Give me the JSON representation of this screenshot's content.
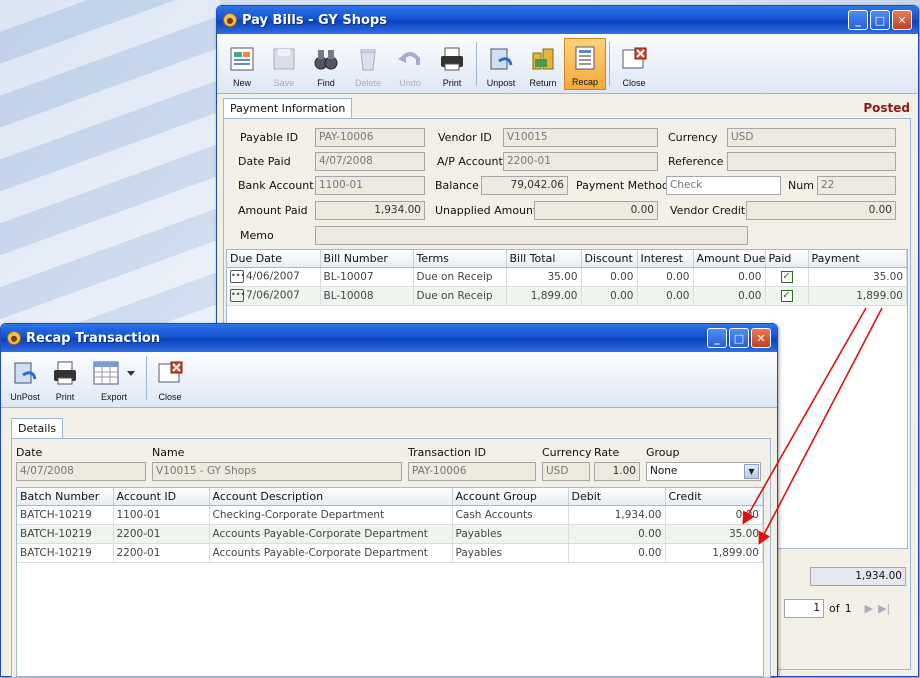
{
  "paybills": {
    "title": "Pay Bills - GY Shops",
    "toolbar": [
      "New",
      "Save",
      "Find",
      "Delete",
      "Undo",
      "Print",
      "Unpost",
      "Return",
      "Recap",
      "Close"
    ],
    "tab": "Payment Information",
    "status": "Posted",
    "fields": {
      "payable_id_label": "Payable ID",
      "payable_id": "PAY-10006",
      "vendor_id_label": "Vendor ID",
      "vendor_id": "V10015",
      "currency_label": "Currency",
      "currency": "USD",
      "date_paid_label": "Date Paid",
      "date_paid": "4/07/2008",
      "ap_account_label": "A/P Account",
      "ap_account": "2200-01",
      "reference_label": "Reference",
      "reference": "",
      "bank_account_label": "Bank Account",
      "bank_account": "1100-01",
      "balance_label": "Balance",
      "balance": "79,042.06",
      "payment_method_label": "Payment Method",
      "payment_method": "Check",
      "num_label": "Num",
      "num": "22",
      "amount_paid_label": "Amount Paid",
      "amount_paid": "1,934.00",
      "unapplied_label": "Unapplied Amount",
      "unapplied": "0.00",
      "vendor_credit_label": "Vendor Credit",
      "vendor_credit": "0.00",
      "memo_label": "Memo",
      "memo": ""
    },
    "grid": {
      "columns": [
        "Due Date",
        "Bill Number",
        "Terms",
        "Bill Total",
        "Discount",
        "Interest",
        "Amount Due",
        "Paid",
        "Payment"
      ],
      "rows": [
        {
          "due_date": "4/06/2007",
          "bill": "BL-10007",
          "terms": "Due on Receip",
          "total": "35.00",
          "discount": "0.00",
          "interest": "0.00",
          "amount_due": "0.00",
          "payment": "35.00"
        },
        {
          "due_date": "7/06/2007",
          "bill": "BL-10008",
          "terms": "Due on Receip",
          "total": "1,899.00",
          "discount": "0.00",
          "interest": "0.00",
          "amount_due": "0.00",
          "payment": "1,899.00"
        }
      ]
    },
    "footer_total": "1,934.00",
    "pager": {
      "page": "1",
      "of": "of",
      "total": "1"
    }
  },
  "recap": {
    "title": "Recap Transaction",
    "toolbar": [
      "UnPost",
      "Print",
      "Export",
      "Close"
    ],
    "tab": "Details",
    "labels": {
      "date": "Date",
      "name": "Name",
      "transaction_id": "Transaction ID",
      "currency": "Currency",
      "rate": "Rate",
      "group": "Group"
    },
    "values": {
      "date": "4/07/2008",
      "name": "V10015 - GY Shops",
      "transaction_id": "PAY-10006",
      "currency": "USD",
      "rate": "1.00",
      "group": "None"
    },
    "grid": {
      "columns": [
        "Batch Number",
        "Account ID",
        "Account Description",
        "Account Group",
        "Debit",
        "Credit"
      ],
      "rows": [
        {
          "batch": "BATCH-10219",
          "account": "1100-01",
          "desc": "Checking-Corporate Department",
          "group": "Cash Accounts",
          "debit": "1,934.00",
          "credit": "0.00"
        },
        {
          "batch": "BATCH-10219",
          "account": "2200-01",
          "desc": "Accounts Payable-Corporate Department",
          "group": "Payables",
          "debit": "0.00",
          "credit": "35.00"
        },
        {
          "batch": "BATCH-10219",
          "account": "2200-01",
          "desc": "Accounts Payable-Corporate Department",
          "group": "Payables",
          "debit": "0.00",
          "credit": "1,899.00"
        }
      ]
    }
  },
  "colors": {
    "title_blue": "#1553d3",
    "arrow_red": "#e01010",
    "active_tool": "#f6a93a"
  }
}
